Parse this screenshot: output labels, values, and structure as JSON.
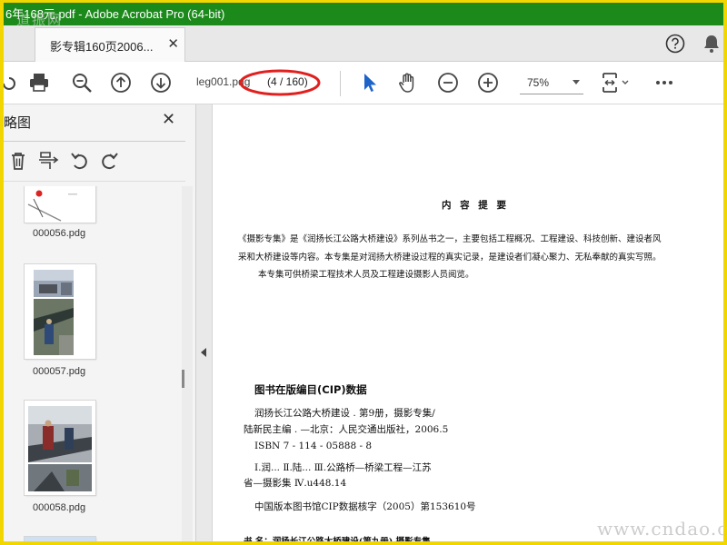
{
  "window": {
    "title": "6年168元.pdf - Adobe Acrobat Pro (64-bit)",
    "watermark_top": "道振网"
  },
  "tabbar": {
    "tab_label": "影专辑160页2006...",
    "tab_close": "✕"
  },
  "toolbar": {
    "filename": "leg001.pdg",
    "page_counter": "(4 / 160)",
    "zoom": "75%",
    "highlight_color": "#e0201e"
  },
  "panel": {
    "title": "略图",
    "close": "✕",
    "thumbnails": [
      {
        "label": "000056.pdg"
      },
      {
        "label": "000057.pdg"
      },
      {
        "label": "000058.pdg"
      }
    ]
  },
  "document": {
    "heading": "内 容 提 要",
    "summary": [
      "《摄影专集》是《润扬长江公路大桥建设》系列丛书之一，主要包括工程概况、工程建设、科技创新、建设者风",
      "采和大桥建设等内容。本专集是对润扬大桥建设过程的真实记录，是建设者们凝心聚力、无私奉献的真实写照。",
      "本专集可供桥梁工程技术人员及工程建设摄影人员阅览。"
    ],
    "cip": {
      "title": "图书在版编目(CIP)数据",
      "lines": [
        "润扬长江公路大桥建设 . 第9册，摄影专集/",
        "陆新民主编 . —北京：人民交通出版社，2006.5",
        "ISBN 7 - 114 - 05888 - 8",
        "Ⅰ.润...  Ⅱ.陆...  Ⅲ.公路桥—桥梁工程—江苏",
        "省—摄影集  Ⅳ.u448.14",
        "中国版本图书馆CIP数据核字（2005）第153610号",
        "书    名：润扬长江公路大桥建设(第九册)  摄影专集"
      ]
    },
    "watermark": "www.cndao.com"
  }
}
